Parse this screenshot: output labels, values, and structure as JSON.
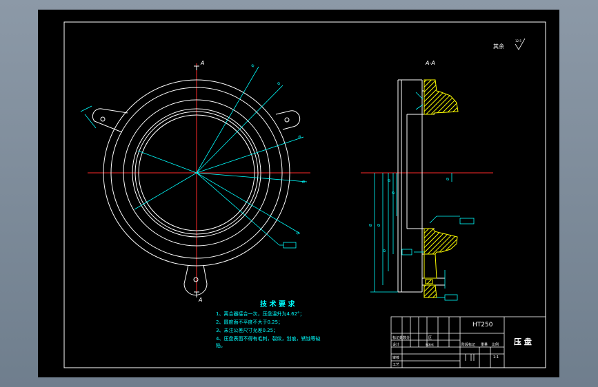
{
  "drawing": {
    "section_label_top": "A",
    "section_label_bottom": "A",
    "section_view_title": "A-A",
    "surface_note": "其余",
    "surface_symbol": "12.5",
    "tech_title": "技 术 要 求",
    "tech_items": [
      "1、离合器接合一次，压盘温升为4.62°；",
      "2、圆度面不平度不大于0.25；",
      "3、未注公差尺寸允差0.25；",
      "4、压盘表面不得有毛刺，裂纹，划痕，锈蚀等缺",
      "陷。"
    ]
  },
  "title_block": {
    "material": "HT250",
    "part_name": "压 盘",
    "row1_a": "标记处数分",
    "row1_b": "区",
    "row2_a": "设计",
    "row2_b": "标准化",
    "row2_c": "阶段标记",
    "row2_d": "重量",
    "row2_e": "比例",
    "row3_a": "审核",
    "row4_a": "工艺",
    "scale": "1:1"
  },
  "colors": {
    "outline": "#ffffff",
    "centerline": "#ff2a2a",
    "dimension": "#00ffff",
    "hatch": "#ffff00",
    "sheet": "#000000"
  }
}
